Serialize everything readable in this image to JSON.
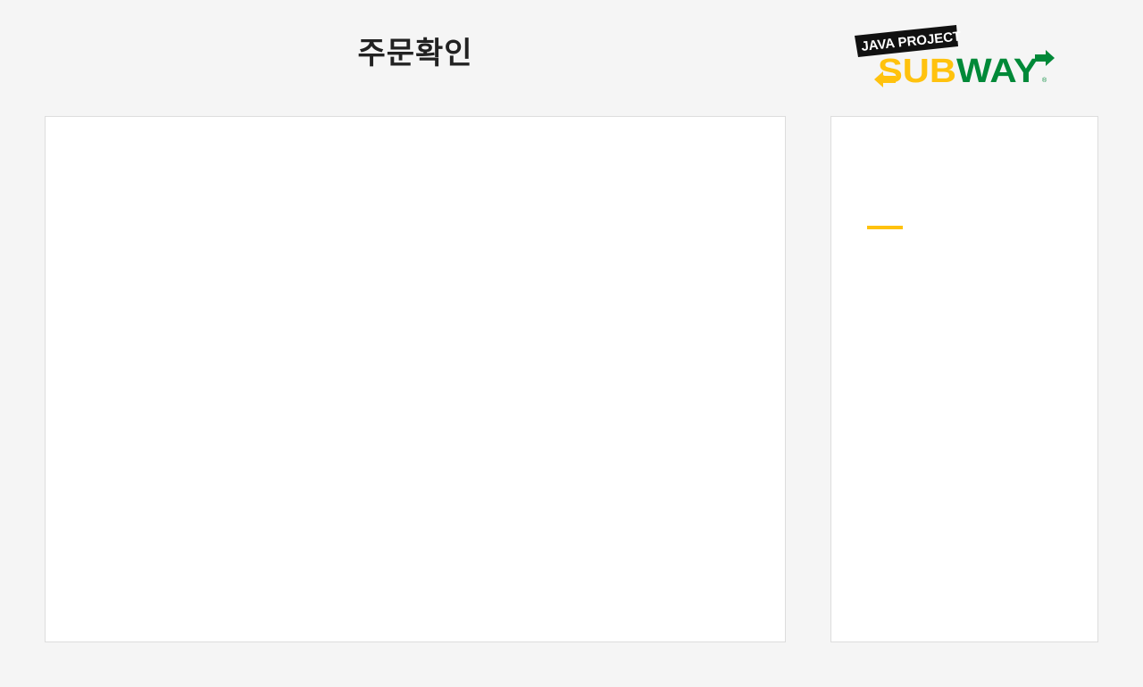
{
  "header": {
    "title": "주문확인"
  },
  "logo": {
    "tagline": "JAVA PROJECT",
    "brand_part1": "SUB",
    "brand_part2": "WAY",
    "registered_mark": "®"
  },
  "colors": {
    "background": "#f5f5f5",
    "panel": "#ffffff",
    "border": "#dddddd",
    "accent_yellow": "#ffc20e",
    "brand_green": "#008938",
    "title_text": "#222222"
  }
}
